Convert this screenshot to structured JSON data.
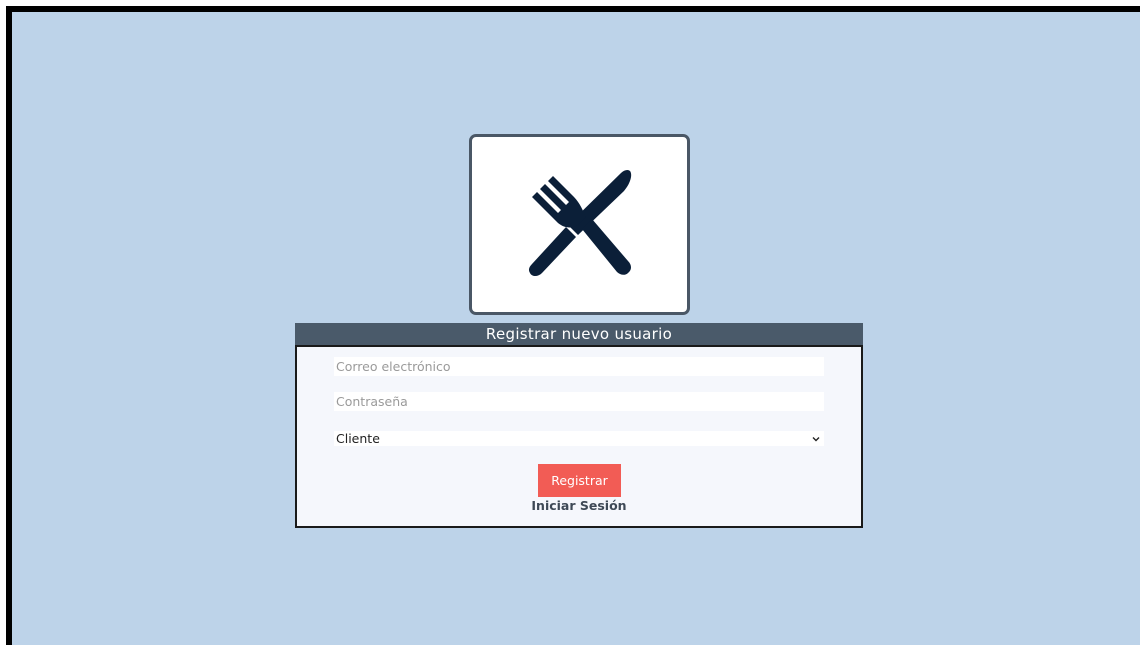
{
  "app": {
    "colors": {
      "background": "#bdd3e9",
      "header": "#4a5a6a",
      "accent_button": "#f25c55",
      "icon": "#0b1f38"
    }
  },
  "logo": {
    "icon": "fork-knife-crossed-icon"
  },
  "form": {
    "title": "Registrar nuevo usuario",
    "email": {
      "placeholder": "Correo electrónico",
      "value": ""
    },
    "password": {
      "placeholder": "Contraseña",
      "value": ""
    },
    "role": {
      "selected": "Cliente",
      "icon": "chevron-down-icon"
    },
    "submit_label": "Registrar",
    "login_link": "Iniciar Sesión"
  }
}
